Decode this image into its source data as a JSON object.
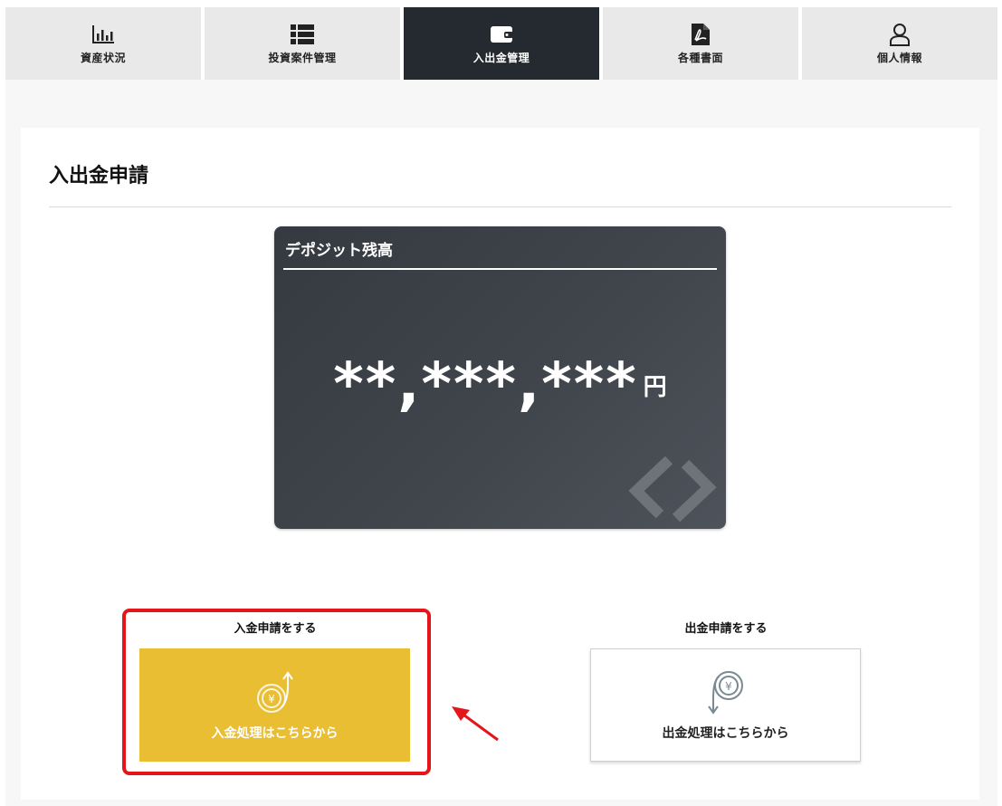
{
  "tabs": [
    {
      "label": "資産状況",
      "icon": "bar-chart-icon"
    },
    {
      "label": "投資案件管理",
      "icon": "list-icon"
    },
    {
      "label": "入出金管理",
      "icon": "wallet-icon",
      "active": true
    },
    {
      "label": "各種書面",
      "icon": "pdf-file-icon"
    },
    {
      "label": "個人情報",
      "icon": "user-icon"
    }
  ],
  "page": {
    "title": "入出金申請"
  },
  "balance_card": {
    "title": "デポジット残高",
    "amount": "**,***,***",
    "unit": "円"
  },
  "deposit": {
    "heading": "入金申請をする",
    "button_label": "入金処理はこちらから",
    "icon": "yen-coin-up-arrow-icon"
  },
  "withdraw": {
    "heading": "出金申請をする",
    "button_label": "出金処理はこちらから",
    "icon": "yen-coin-down-arrow-icon"
  },
  "colors": {
    "active_tab": "#252a31",
    "deposit_button": "#e9be33",
    "highlight": "#e5161a"
  }
}
